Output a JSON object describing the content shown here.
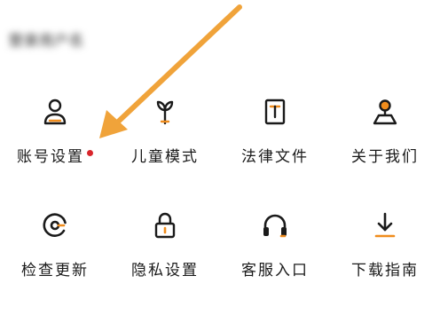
{
  "profile": {
    "name_blurred": "登录用户名"
  },
  "colors": {
    "accent": "#f08c1c",
    "dot": "#d9262c",
    "icon": "#1a1a1a"
  },
  "menu": {
    "items": [
      {
        "label": "账号设置",
        "icon": "person-icon",
        "badge": true
      },
      {
        "label": "儿童模式",
        "icon": "sprout-icon",
        "badge": false
      },
      {
        "label": "法律文件",
        "icon": "document-icon",
        "badge": false
      },
      {
        "label": "关于我们",
        "icon": "location-pin-icon",
        "badge": false
      },
      {
        "label": "检查更新",
        "icon": "refresh-icon",
        "badge": false
      },
      {
        "label": "隐私设置",
        "icon": "lock-icon",
        "badge": false
      },
      {
        "label": "客服入口",
        "icon": "headphones-icon",
        "badge": false
      },
      {
        "label": "下载指南",
        "icon": "download-icon",
        "badge": false
      }
    ]
  }
}
